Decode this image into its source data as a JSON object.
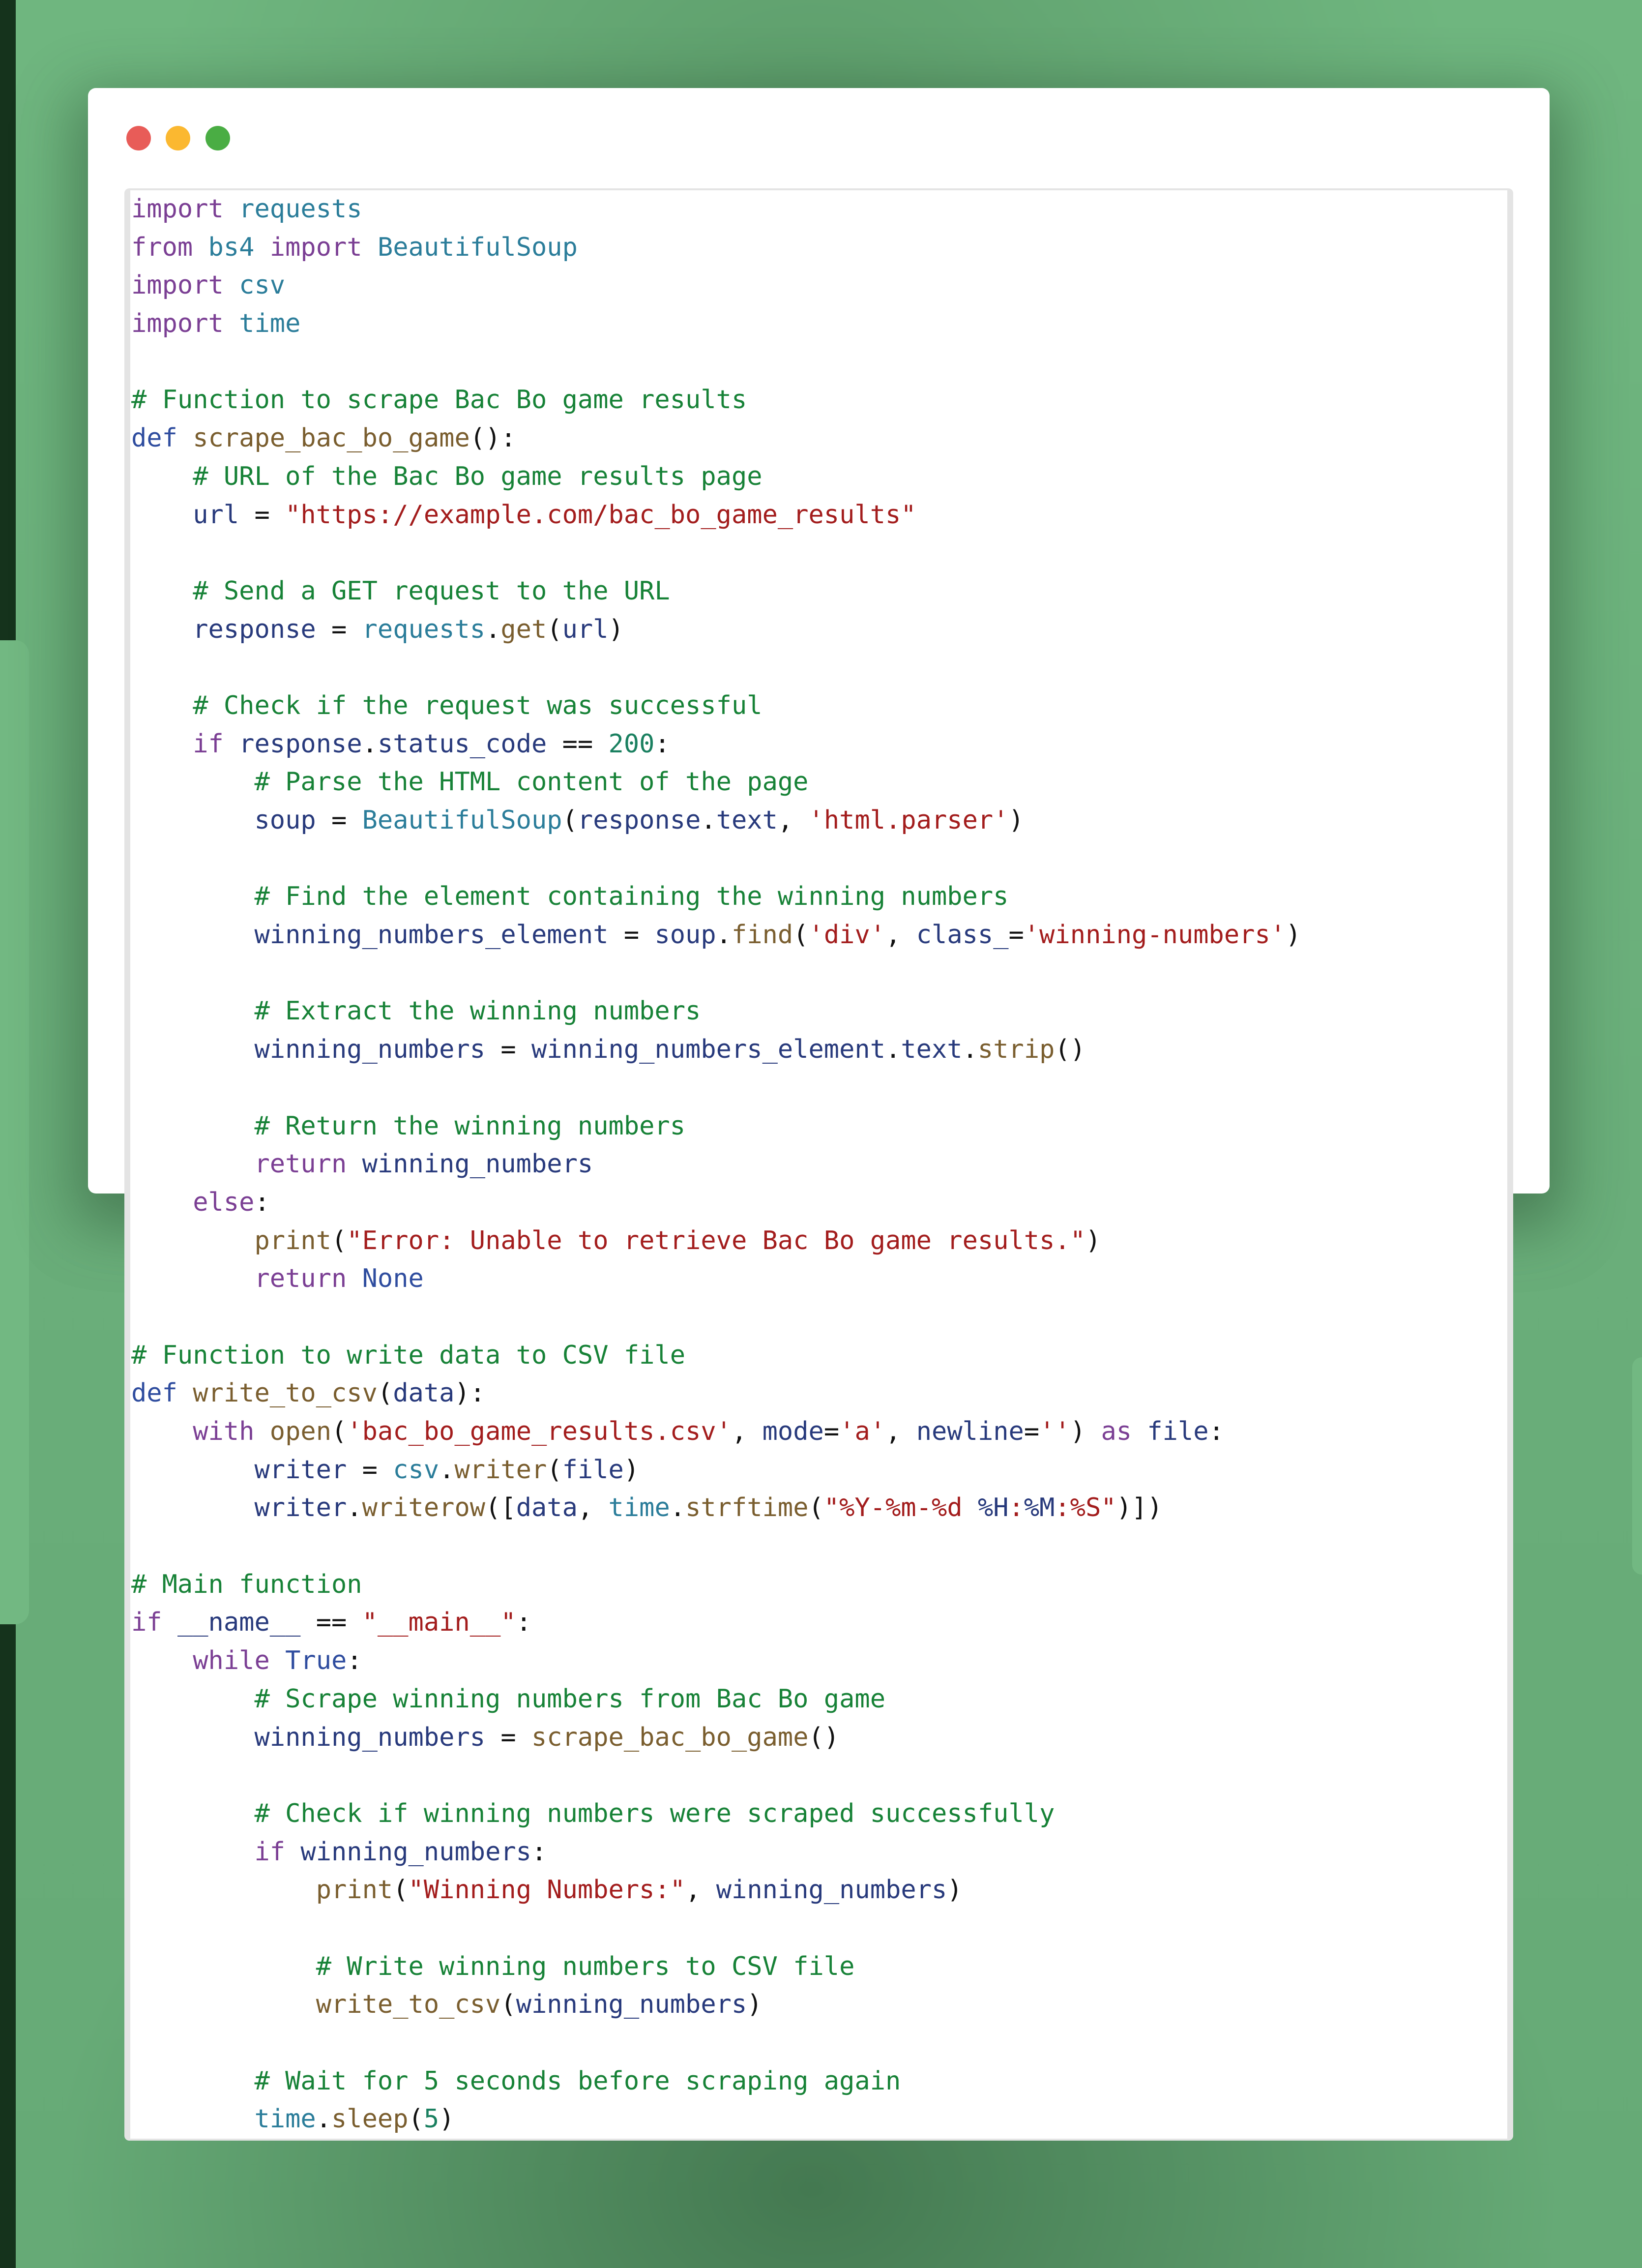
{
  "window": {
    "controls": [
      {
        "name": "close",
        "color": "#e85c58"
      },
      {
        "name": "minimize",
        "color": "#fbb830"
      },
      {
        "name": "maximize",
        "color": "#4aad44"
      }
    ]
  },
  "code": {
    "language": "python",
    "lines": [
      [
        [
          "kw",
          "import"
        ],
        [
          "p",
          " "
        ],
        [
          "mod",
          "requests"
        ]
      ],
      [
        [
          "kw",
          "from"
        ],
        [
          "p",
          " "
        ],
        [
          "mod",
          "bs4"
        ],
        [
          "p",
          " "
        ],
        [
          "kw",
          "import"
        ],
        [
          "p",
          " "
        ],
        [
          "mod",
          "BeautifulSoup"
        ]
      ],
      [
        [
          "kw",
          "import"
        ],
        [
          "p",
          " "
        ],
        [
          "mod",
          "csv"
        ]
      ],
      [
        [
          "kw",
          "import"
        ],
        [
          "p",
          " "
        ],
        [
          "mod",
          "time"
        ]
      ],
      [],
      [
        [
          "com",
          "# Function to scrape Bac Bo game results"
        ]
      ],
      [
        [
          "def",
          "def"
        ],
        [
          "p",
          " "
        ],
        [
          "fn",
          "scrape_bac_bo_game"
        ],
        [
          "p",
          "():"
        ]
      ],
      [
        [
          "p",
          "    "
        ],
        [
          "com",
          "# URL of the Bac Bo game results page"
        ]
      ],
      [
        [
          "p",
          "    "
        ],
        [
          "var",
          "url"
        ],
        [
          "p",
          " = "
        ],
        [
          "str",
          "\"https://example.com/bac_bo_game_results\""
        ]
      ],
      [],
      [
        [
          "p",
          "    "
        ],
        [
          "com",
          "# Send a GET request to the URL"
        ]
      ],
      [
        [
          "p",
          "    "
        ],
        [
          "var",
          "response"
        ],
        [
          "p",
          " = "
        ],
        [
          "mod",
          "requests"
        ],
        [
          "p",
          "."
        ],
        [
          "fn",
          "get"
        ],
        [
          "p",
          "("
        ],
        [
          "var",
          "url"
        ],
        [
          "p",
          ")"
        ]
      ],
      [],
      [
        [
          "p",
          "    "
        ],
        [
          "com",
          "# Check if the request was successful"
        ]
      ],
      [
        [
          "p",
          "    "
        ],
        [
          "kw",
          "if"
        ],
        [
          "p",
          " "
        ],
        [
          "var",
          "response"
        ],
        [
          "p",
          "."
        ],
        [
          "var",
          "status_code"
        ],
        [
          "p",
          " == "
        ],
        [
          "num",
          "200"
        ],
        [
          "p",
          ":"
        ]
      ],
      [
        [
          "p",
          "        "
        ],
        [
          "com",
          "# Parse the HTML content of the page"
        ]
      ],
      [
        [
          "p",
          "        "
        ],
        [
          "var",
          "soup"
        ],
        [
          "p",
          " = "
        ],
        [
          "mod",
          "BeautifulSoup"
        ],
        [
          "p",
          "("
        ],
        [
          "var",
          "response"
        ],
        [
          "p",
          "."
        ],
        [
          "var",
          "text"
        ],
        [
          "p",
          ", "
        ],
        [
          "str",
          "'html.parser'"
        ],
        [
          "p",
          ")"
        ]
      ],
      [],
      [
        [
          "p",
          "        "
        ],
        [
          "com",
          "# Find the element containing the winning numbers"
        ]
      ],
      [
        [
          "p",
          "        "
        ],
        [
          "var",
          "winning_numbers_element"
        ],
        [
          "p",
          " = "
        ],
        [
          "var",
          "soup"
        ],
        [
          "p",
          "."
        ],
        [
          "fn",
          "find"
        ],
        [
          "p",
          "("
        ],
        [
          "str",
          "'div'"
        ],
        [
          "p",
          ", "
        ],
        [
          "var",
          "class_"
        ],
        [
          "p",
          "="
        ],
        [
          "str",
          "'winning-numbers'"
        ],
        [
          "p",
          ")"
        ]
      ],
      [],
      [
        [
          "p",
          "        "
        ],
        [
          "com",
          "# Extract the winning numbers"
        ]
      ],
      [
        [
          "p",
          "        "
        ],
        [
          "var",
          "winning_numbers"
        ],
        [
          "p",
          " = "
        ],
        [
          "var",
          "winning_numbers_element"
        ],
        [
          "p",
          "."
        ],
        [
          "var",
          "text"
        ],
        [
          "p",
          "."
        ],
        [
          "fn",
          "strip"
        ],
        [
          "p",
          "()"
        ]
      ],
      [],
      [
        [
          "p",
          "        "
        ],
        [
          "com",
          "# Return the winning numbers"
        ]
      ],
      [
        [
          "p",
          "        "
        ],
        [
          "kw",
          "return"
        ],
        [
          "p",
          " "
        ],
        [
          "var",
          "winning_numbers"
        ]
      ],
      [
        [
          "p",
          "    "
        ],
        [
          "kw",
          "else"
        ],
        [
          "p",
          ":"
        ]
      ],
      [
        [
          "p",
          "        "
        ],
        [
          "fn",
          "print"
        ],
        [
          "p",
          "("
        ],
        [
          "str",
          "\"Error: Unable to retrieve Bac Bo game results.\""
        ],
        [
          "p",
          ")"
        ]
      ],
      [
        [
          "p",
          "        "
        ],
        [
          "kw",
          "return"
        ],
        [
          "p",
          " "
        ],
        [
          "def",
          "None"
        ]
      ],
      [],
      [
        [
          "com",
          "# Function to write data to CSV file"
        ]
      ],
      [
        [
          "def",
          "def"
        ],
        [
          "p",
          " "
        ],
        [
          "fn",
          "write_to_csv"
        ],
        [
          "p",
          "("
        ],
        [
          "var",
          "data"
        ],
        [
          "p",
          "):"
        ]
      ],
      [
        [
          "p",
          "    "
        ],
        [
          "kw",
          "with"
        ],
        [
          "p",
          " "
        ],
        [
          "fn",
          "open"
        ],
        [
          "p",
          "("
        ],
        [
          "str",
          "'bac_bo_game_results.csv'"
        ],
        [
          "p",
          ", "
        ],
        [
          "var",
          "mode"
        ],
        [
          "p",
          "="
        ],
        [
          "str",
          "'a'"
        ],
        [
          "p",
          ", "
        ],
        [
          "var",
          "newline"
        ],
        [
          "p",
          "="
        ],
        [
          "str",
          "''"
        ],
        [
          "p",
          ") "
        ],
        [
          "kw",
          "as"
        ],
        [
          "p",
          " "
        ],
        [
          "var",
          "file"
        ],
        [
          "p",
          ":"
        ]
      ],
      [
        [
          "p",
          "        "
        ],
        [
          "var",
          "writer"
        ],
        [
          "p",
          " = "
        ],
        [
          "mod",
          "csv"
        ],
        [
          "p",
          "."
        ],
        [
          "fn",
          "writer"
        ],
        [
          "p",
          "("
        ],
        [
          "var",
          "file"
        ],
        [
          "p",
          ")"
        ]
      ],
      [
        [
          "p",
          "        "
        ],
        [
          "var",
          "writer"
        ],
        [
          "p",
          "."
        ],
        [
          "fn",
          "writerow"
        ],
        [
          "p",
          "(["
        ],
        [
          "var",
          "data"
        ],
        [
          "p",
          ", "
        ],
        [
          "mod",
          "time"
        ],
        [
          "p",
          "."
        ],
        [
          "fn",
          "strftime"
        ],
        [
          "p",
          "("
        ],
        [
          "str",
          "\"%Y-%m-%d "
        ],
        [
          "var",
          "%H"
        ],
        [
          "str",
          ":"
        ],
        [
          "var",
          "%M"
        ],
        [
          "str",
          ":%S\""
        ],
        [
          "p",
          ")])"
        ]
      ],
      [],
      [
        [
          "com",
          "# Main function"
        ]
      ],
      [
        [
          "kw",
          "if"
        ],
        [
          "p",
          " "
        ],
        [
          "var",
          "__name__"
        ],
        [
          "p",
          " == "
        ],
        [
          "str",
          "\"__main__\""
        ],
        [
          "p",
          ":"
        ]
      ],
      [
        [
          "p",
          "    "
        ],
        [
          "kw",
          "while"
        ],
        [
          "p",
          " "
        ],
        [
          "def",
          "True"
        ],
        [
          "p",
          ":"
        ]
      ],
      [
        [
          "p",
          "        "
        ],
        [
          "com",
          "# Scrape winning numbers from Bac Bo game"
        ]
      ],
      [
        [
          "p",
          "        "
        ],
        [
          "var",
          "winning_numbers"
        ],
        [
          "p",
          " = "
        ],
        [
          "fn",
          "scrape_bac_bo_game"
        ],
        [
          "p",
          "()"
        ]
      ],
      [],
      [
        [
          "p",
          "        "
        ],
        [
          "com",
          "# Check if winning numbers were scraped successfully"
        ]
      ],
      [
        [
          "p",
          "        "
        ],
        [
          "kw",
          "if"
        ],
        [
          "p",
          " "
        ],
        [
          "var",
          "winning_numbers"
        ],
        [
          "p",
          ":"
        ]
      ],
      [
        [
          "p",
          "            "
        ],
        [
          "fn",
          "print"
        ],
        [
          "p",
          "("
        ],
        [
          "str",
          "\"Winning Numbers:\""
        ],
        [
          "p",
          ", "
        ],
        [
          "var",
          "winning_numbers"
        ],
        [
          "p",
          ")"
        ]
      ],
      [],
      [
        [
          "p",
          "            "
        ],
        [
          "com",
          "# Write winning numbers to CSV file"
        ]
      ],
      [
        [
          "p",
          "            "
        ],
        [
          "fn",
          "write_to_csv"
        ],
        [
          "p",
          "("
        ],
        [
          "var",
          "winning_numbers"
        ],
        [
          "p",
          ")"
        ]
      ],
      [],
      [
        [
          "p",
          "        "
        ],
        [
          "com",
          "# Wait for 5 seconds before scraping again"
        ]
      ],
      [
        [
          "p",
          "        "
        ],
        [
          "mod",
          "time"
        ],
        [
          "p",
          "."
        ],
        [
          "fn",
          "sleep"
        ],
        [
          "p",
          "("
        ],
        [
          "num",
          "5"
        ],
        [
          "p",
          ")"
        ]
      ]
    ]
  }
}
